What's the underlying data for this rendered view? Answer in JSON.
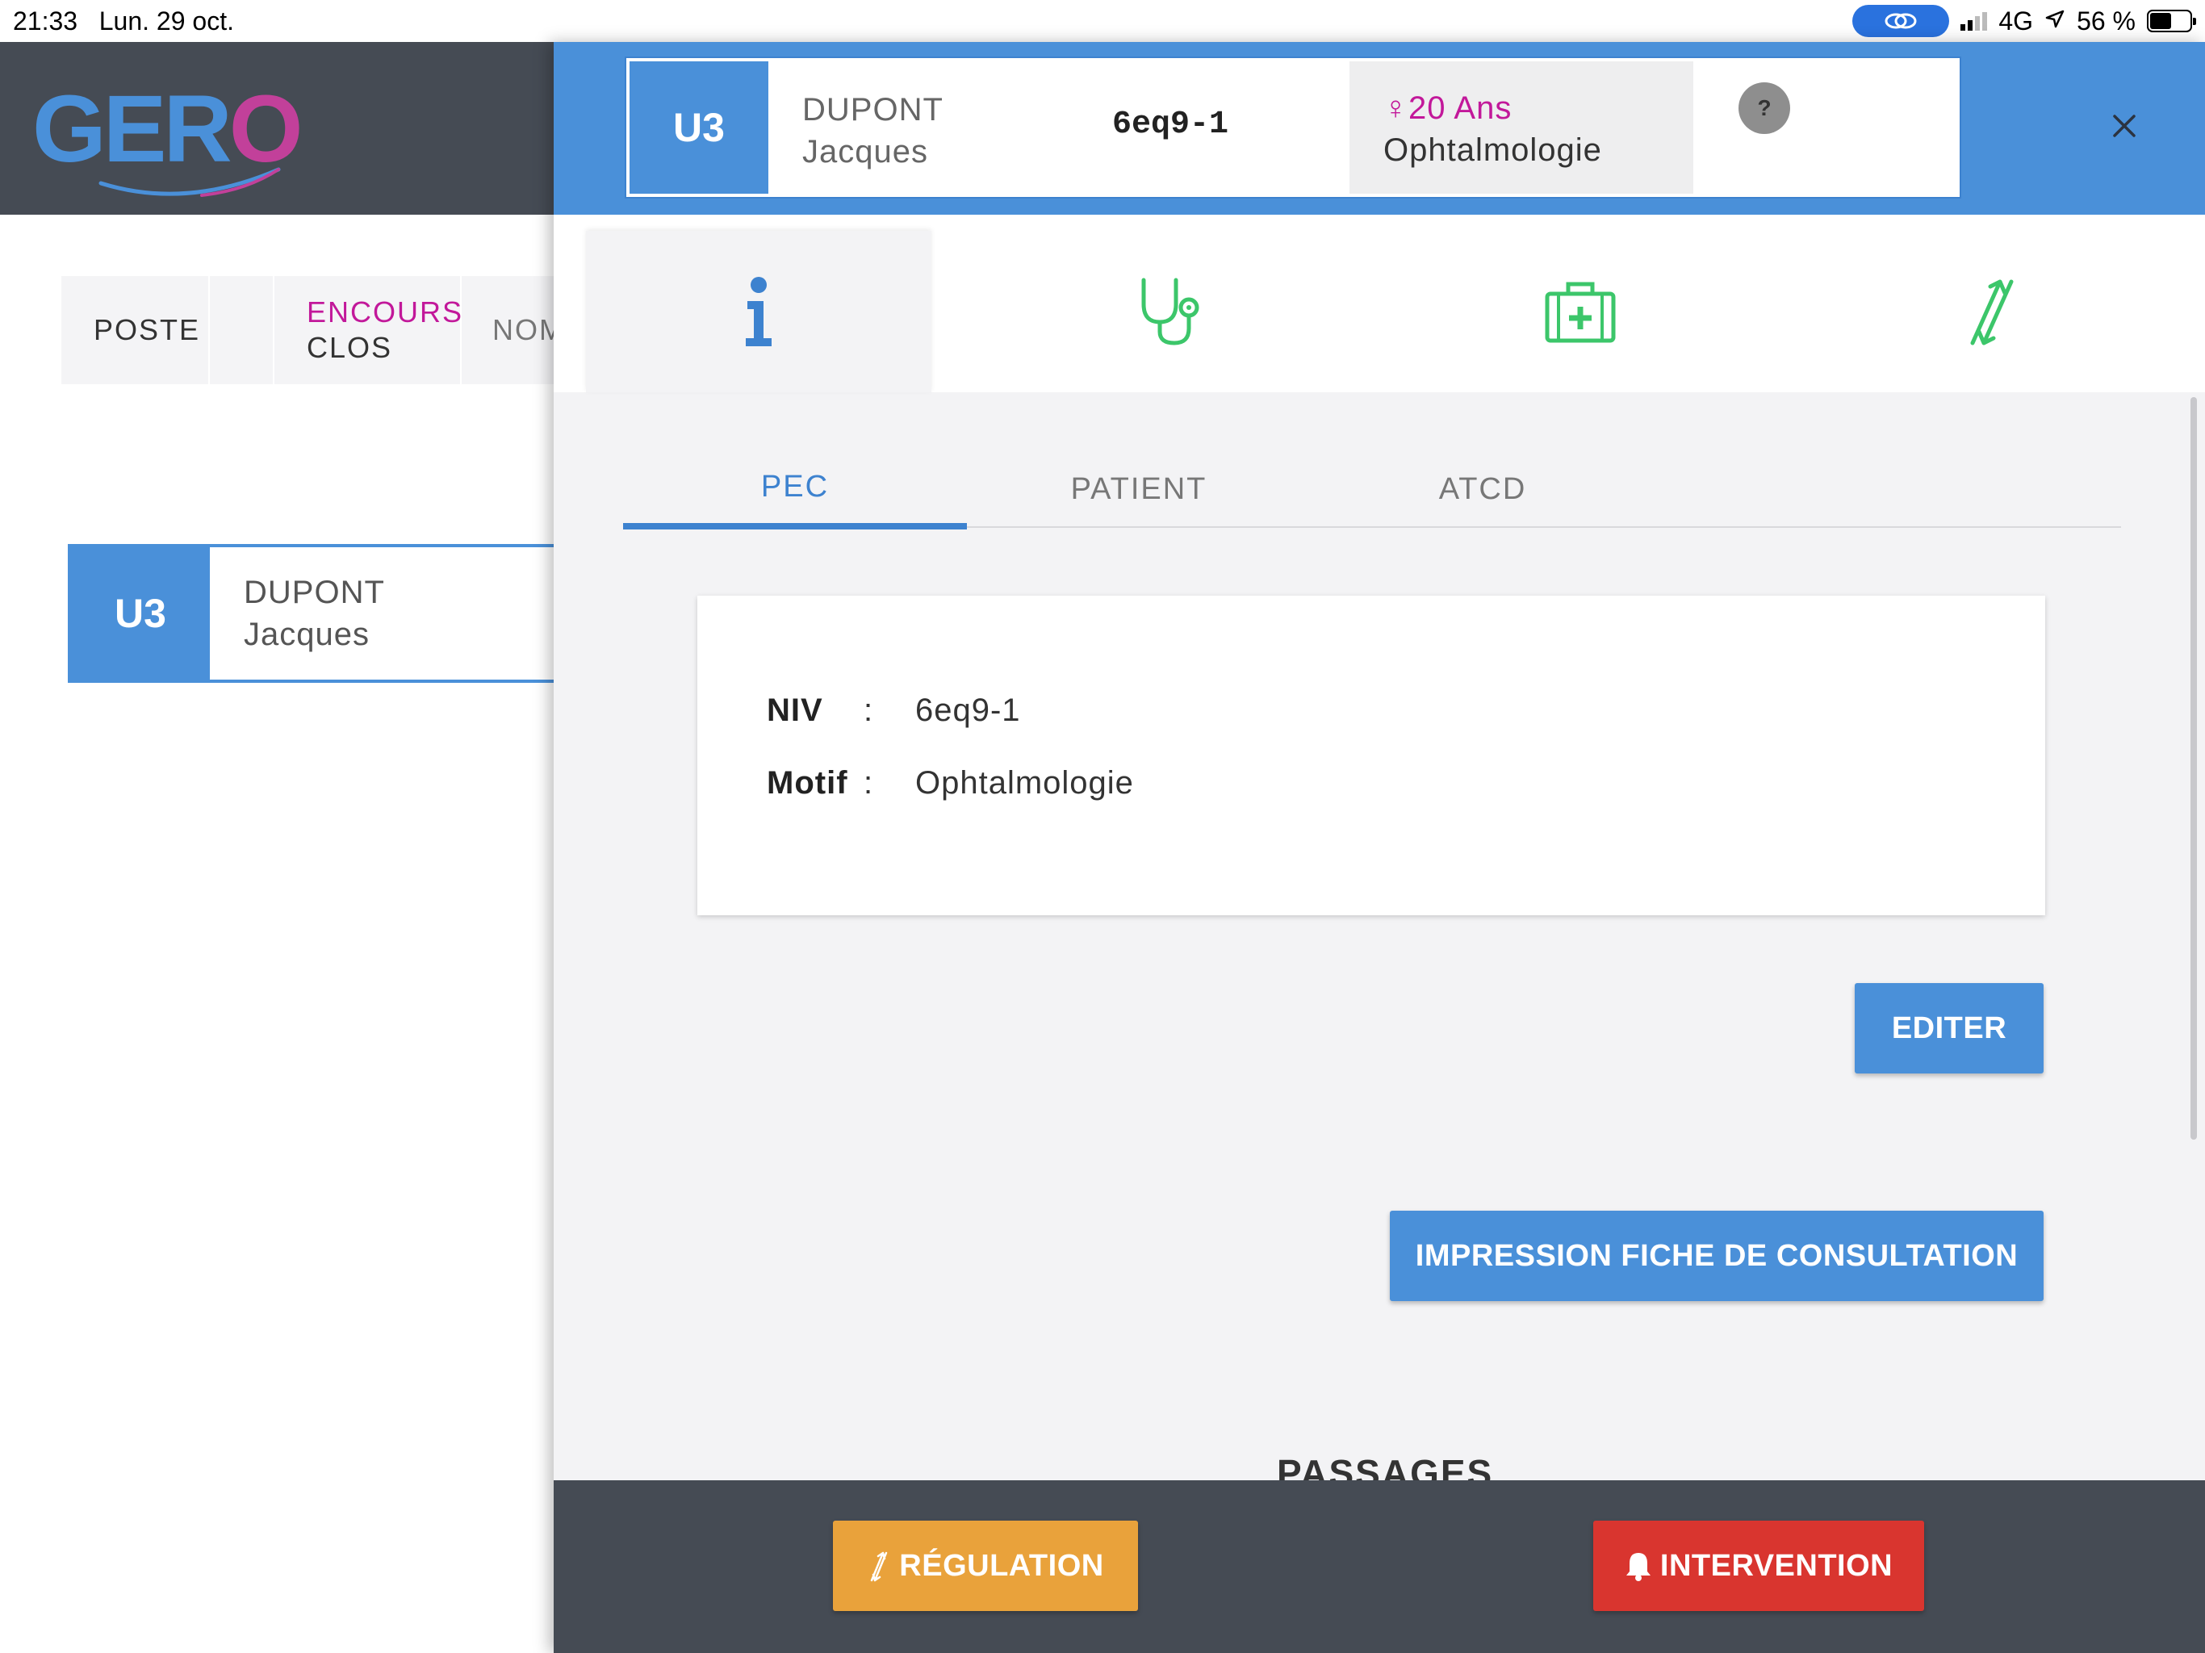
{
  "status_bar": {
    "time": "21:33",
    "date": "Lun. 29 oct.",
    "network": "4G",
    "battery": "56 %"
  },
  "app": {
    "logo": "GERO",
    "tabs": [
      "POSTE",
      "",
      "ENCOURS",
      "CLOS",
      "NOM"
    ],
    "patient": {
      "unit": "U3",
      "last_name": "DUPONT",
      "first_name": "Jacques"
    }
  },
  "panel": {
    "header": {
      "unit": "U3",
      "last_name": "DUPONT",
      "first_name": "Jacques",
      "niv": "6eq9-1",
      "age": "♀20 Ans",
      "motif": "Ophtalmologie",
      "help": "?"
    },
    "icon_tabs": [
      "info-icon",
      "stethoscope-icon",
      "medical-kit-icon",
      "transfer-icon"
    ],
    "subtabs": [
      "PEC",
      "PATIENT",
      "ATCD"
    ],
    "info": {
      "niv_label": "NIV",
      "niv_value": "6eq9-1",
      "motif_label": "Motif",
      "motif_value": "Ophtalmologie",
      "separator": ":"
    },
    "buttons": {
      "edit": "EDITER",
      "print": "IMPRESSION FICHE DE CONSULTATION",
      "regulation": "RÉGULATION",
      "intervention": "INTERVENTION"
    },
    "section_title": "PASSAGES"
  },
  "colors": {
    "primary_blue": "#4a90d9",
    "dark_header": "#454b54",
    "accent_pink": "#c2189a",
    "icon_green": "#3cc66a",
    "regulation_orange": "#e9a23b",
    "intervention_red": "#d9352f"
  }
}
